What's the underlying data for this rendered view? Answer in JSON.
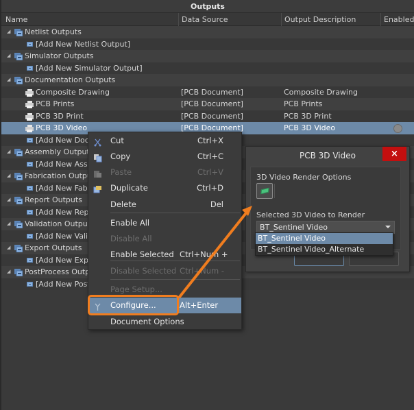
{
  "panel": {
    "title": "Outputs",
    "columns": [
      "Name",
      "Data Source",
      "Output Description",
      "Enabled"
    ]
  },
  "rows": [
    {
      "type": "group",
      "name": "Netlist Outputs"
    },
    {
      "type": "add",
      "name": "[Add New Netlist Output]"
    },
    {
      "type": "group",
      "name": "Simulator Outputs"
    },
    {
      "type": "add",
      "name": "[Add New Simulator Output]"
    },
    {
      "type": "group",
      "name": "Documentation Outputs"
    },
    {
      "type": "output",
      "name": "Composite Drawing",
      "data_source": "[PCB Document]",
      "description": "Composite Drawing"
    },
    {
      "type": "output",
      "name": "PCB Prints",
      "data_source": "[PCB Document]",
      "description": "PCB Prints"
    },
    {
      "type": "output",
      "name": "PCB 3D Print",
      "data_source": "[PCB Document]",
      "description": "PCB 3D Print"
    },
    {
      "type": "output",
      "name": "PCB 3D Video",
      "data_source": "[PCB Document]",
      "description": "PCB 3D Video",
      "selected": true,
      "enabled": false
    },
    {
      "type": "add",
      "name": "[Add New Docu"
    },
    {
      "type": "group",
      "name": "Assembly Outputs"
    },
    {
      "type": "add",
      "name": "[Add New Assen"
    },
    {
      "type": "group",
      "name": "Fabrication Outputs"
    },
    {
      "type": "add",
      "name": "[Add New Fabric"
    },
    {
      "type": "group",
      "name": "Report Outputs"
    },
    {
      "type": "add",
      "name": "[Add New Repor"
    },
    {
      "type": "group",
      "name": "Validation Outputs"
    },
    {
      "type": "add",
      "name": "[Add New Valida"
    },
    {
      "type": "group",
      "name": "Export Outputs"
    },
    {
      "type": "add",
      "name": "[Add New Expor"
    },
    {
      "type": "group",
      "name": "PostProcess Outputs"
    },
    {
      "type": "add",
      "name": "[Add New PostP"
    }
  ],
  "context_menu": {
    "items": [
      {
        "label": "Cut",
        "shortcut": "Ctrl+X",
        "icon": "cut-icon",
        "disabled": false
      },
      {
        "label": "Copy",
        "shortcut": "Ctrl+C",
        "icon": "copy-icon",
        "disabled": false
      },
      {
        "label": "Paste",
        "shortcut": "Ctrl+V",
        "icon": "paste-icon",
        "disabled": true
      },
      {
        "label": "Duplicate",
        "shortcut": "Ctrl+D",
        "icon": "duplicate-icon",
        "disabled": false
      },
      {
        "label": "Delete",
        "shortcut": "Del",
        "icon": "",
        "disabled": false
      },
      {
        "label": "Enable All",
        "shortcut": "",
        "disabled": false
      },
      {
        "label": "Disable All",
        "shortcut": "",
        "disabled": true
      },
      {
        "label": "Enable Selected",
        "shortcut": "Ctrl+Num +",
        "disabled": false
      },
      {
        "label": "Disable Selected",
        "shortcut": "Ctrl+Num -",
        "disabled": true
      },
      {
        "label": "Page Setup...",
        "shortcut": "",
        "disabled": true
      },
      {
        "label": "Configure...",
        "shortcut": "Alt+Enter",
        "icon": "configure-icon",
        "disabled": false,
        "highlighted": true
      },
      {
        "label": "Document Options",
        "shortcut": "",
        "disabled": false
      }
    ]
  },
  "dialog": {
    "title": "PCB 3D Video",
    "close_label": "×",
    "render_options_label": "3D Video Render Options",
    "selected_video_label": "Selected 3D Video to Render",
    "selected_value": "BT_Sentinel Video",
    "options": [
      "BT_Sentinel Video",
      "BT_Sentinel Video_Alternate"
    ]
  },
  "annotation": {
    "color": "#f07d1f"
  }
}
